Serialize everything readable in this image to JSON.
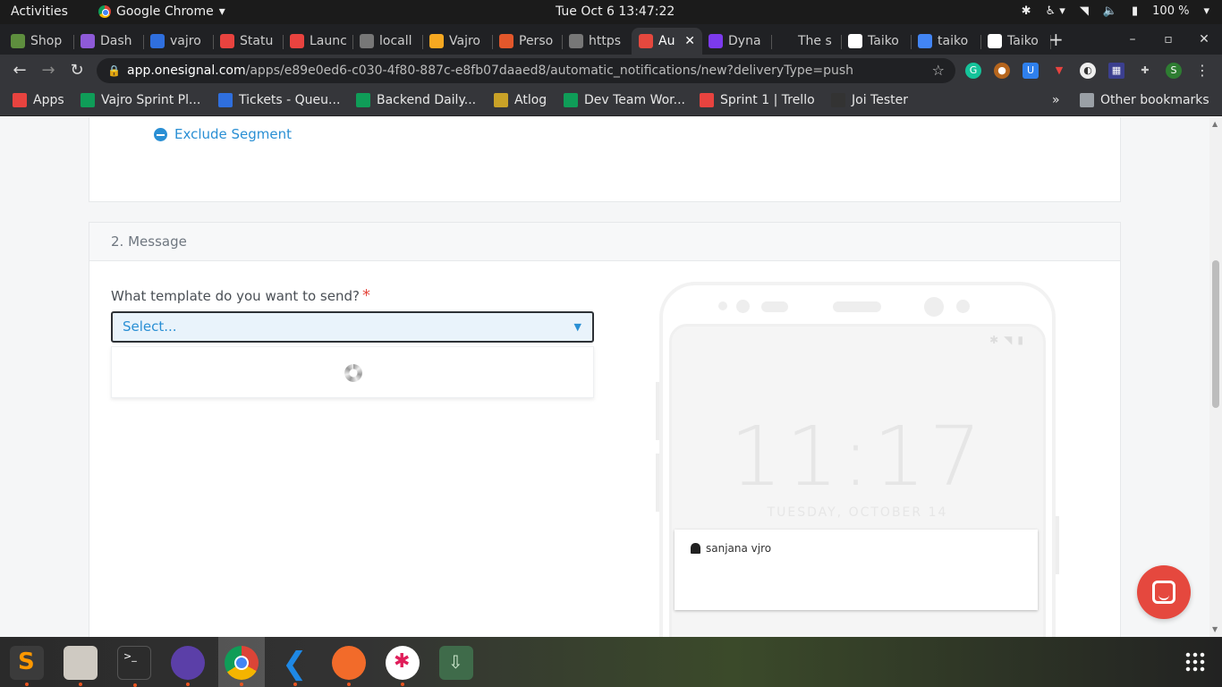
{
  "system": {
    "activities": "Activities",
    "app_name": "Google Chrome",
    "app_caret": "▾",
    "clock": "Tue Oct 6  13:47:22",
    "battery": "100 %"
  },
  "tabs": [
    {
      "label": "Shop",
      "color": "#5e8e3e"
    },
    {
      "label": "Dash",
      "color": "#8e5ad8"
    },
    {
      "label": "vajro",
      "color": "#2f6fde"
    },
    {
      "label": "Statu",
      "color": "#e8433f"
    },
    {
      "label": "Launc",
      "color": "#e8433f"
    },
    {
      "label": "locall",
      "color": "#777777"
    },
    {
      "label": "Vajro",
      "color": "#f6a821"
    },
    {
      "label": "Perso",
      "color": "#e2572b"
    },
    {
      "label": "https",
      "color": "#777777"
    },
    {
      "label": "Au",
      "color": "#e5483e",
      "active": true
    },
    {
      "label": "Dyna",
      "color": "#7c3aed"
    },
    {
      "label": "The s",
      "color": "#202124"
    },
    {
      "label": "Taiko",
      "color": "#ffffff"
    },
    {
      "label": "taiko",
      "color": "#4285f4"
    },
    {
      "label": "Taiko",
      "color": "#ffffff"
    }
  ],
  "address": {
    "host": "app.onesignal.com",
    "path": "/apps/e89e0ed6-c030-4f80-887c-e8fb07daaed8/automatic_notifications/new?deliveryType=push"
  },
  "bookmarks": [
    {
      "label": "Apps",
      "color": "#e8433f"
    },
    {
      "label": "Vajro Sprint Pl...",
      "color": "#0f9d58"
    },
    {
      "label": "Tickets - Queu...",
      "color": "#2f6fde"
    },
    {
      "label": "Backend Daily...",
      "color": "#0f9d58"
    },
    {
      "label": "Atlog",
      "color": "#c9a227"
    },
    {
      "label": "Dev Team Wor...",
      "color": "#0f9d58"
    },
    {
      "label": "Sprint 1 | Trello",
      "color": "#e8433f"
    },
    {
      "label": "Joi Tester",
      "color": "#333333"
    }
  ],
  "bookmarks_more": "»",
  "other_bookmarks": "Other bookmarks",
  "page": {
    "exclude_segment": "Exclude Segment",
    "section_title": "2. Message",
    "template_question": "What template do you want to send?",
    "required_mark": "*",
    "select_placeholder": "Select...",
    "caret": "▼"
  },
  "preview": {
    "time": "11:17",
    "date": "TUESDAY, OCTOBER 14",
    "app_name": "sanjana vjro"
  },
  "colors": {
    "accent": "#2a8fd4",
    "required": "#e5483e",
    "chat": "#e5483e"
  }
}
